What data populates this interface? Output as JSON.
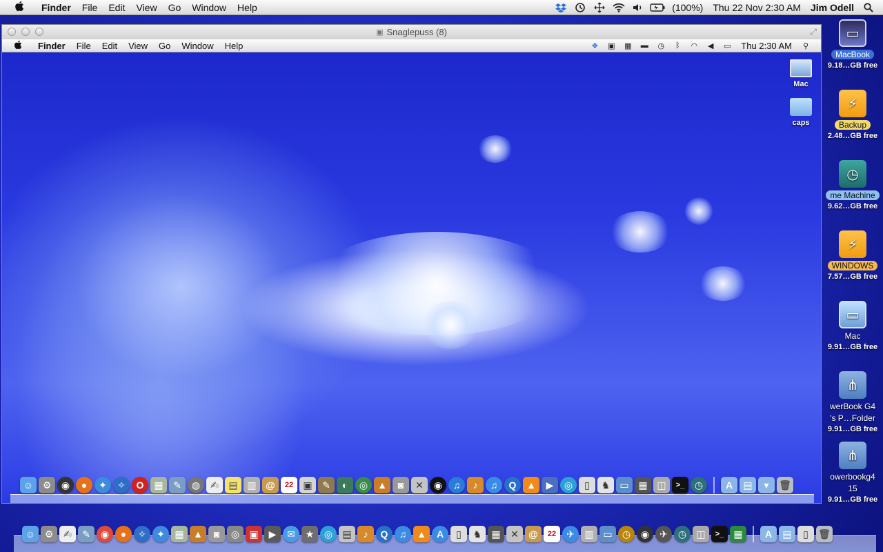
{
  "host_menubar": {
    "apple": "",
    "app_name": "Finder",
    "menus": [
      "File",
      "Edit",
      "View",
      "Go",
      "Window",
      "Help"
    ],
    "battery": "(100%)",
    "datetime": "Thu 22 Nov  2:30 AM",
    "user": "Jim Odell",
    "status_icons": [
      "dropbox-icon",
      "time-machine-icon",
      "move-icon",
      "wifi-icon",
      "volume-icon",
      "battery-icon"
    ]
  },
  "guest_window": {
    "title": "Snaglepuss (8)",
    "menubar": {
      "apple": "",
      "app_name": "Finder",
      "menus": [
        "File",
        "Edit",
        "View",
        "Go",
        "Window",
        "Help"
      ],
      "clock": "Thu 2:30 AM"
    },
    "desktop_icons": [
      {
        "label": "Mac",
        "icon": "laptop-icon"
      },
      {
        "label": "caps",
        "icon": "folder-icon"
      }
    ]
  },
  "host_desktop": {
    "volumes": [
      {
        "name": "MacBook",
        "free": "9.18…GB free",
        "icon": "macbook-drive-icon",
        "highlight": "#3d6fd8"
      },
      {
        "name": "Backup",
        "free": "2.48…GB free",
        "icon": "usb-drive-icon",
        "highlight": "#f2da6a"
      },
      {
        "name": "me Machine",
        "free": "9.62…GB free",
        "icon": "time-machine-drive-icon",
        "highlight": "#8fc0f0"
      },
      {
        "name": "WINDOWS",
        "free": "7.57…GB free",
        "icon": "usb-drive-icon",
        "highlight": "#f4b850"
      },
      {
        "name": "Mac",
        "free": "9.91…GB free",
        "icon": "laptop-drive-icon",
        "highlight": ""
      },
      {
        "name": "werBook G4",
        "name2": "'s P…Folder",
        "free": "9.91…GB free",
        "icon": "network-share-icon",
        "highlight": ""
      },
      {
        "name": "owerbookg4",
        "name2": "15",
        "free": "9.91…GB free",
        "icon": "network-share-icon",
        "highlight": ""
      }
    ]
  },
  "colors": {
    "desktop_blue": "#2a3ae0",
    "selection_blue": "#3d6fd8"
  },
  "calendar_day": "22"
}
